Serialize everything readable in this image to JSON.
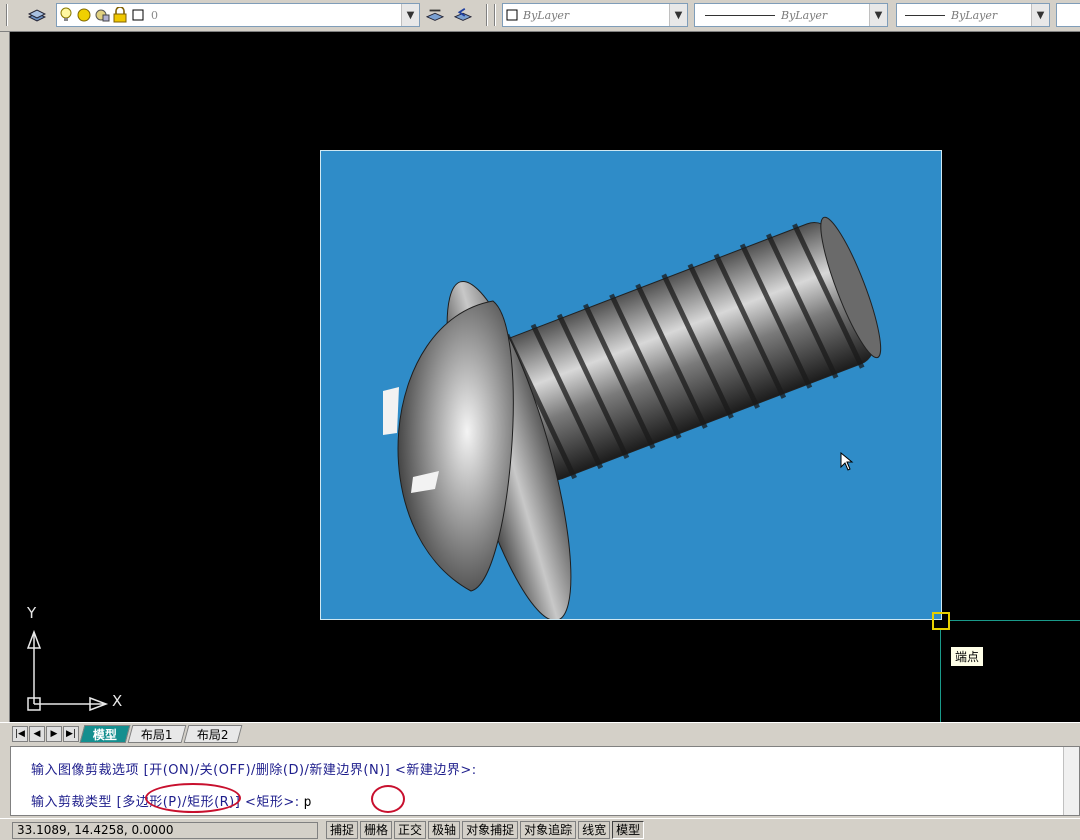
{
  "toolbar": {
    "layer_combo_value": "0",
    "color_combo_value": "ByLayer",
    "linetype_combo_value": "ByLayer",
    "lineweight_combo_value": "ByLayer"
  },
  "canvas": {
    "tooltip": "端点",
    "ucs_y_label": "Y",
    "ucs_x_label": "X",
    "background_color": "#000000",
    "image_bg_color": "#2f8cc8"
  },
  "tabs": [
    {
      "label": "模型",
      "active": true
    },
    {
      "label": "布局1",
      "active": false
    },
    {
      "label": "布局2",
      "active": false
    }
  ],
  "command": {
    "line1": "输入图像剪裁选项 [开(ON)/关(OFF)/删除(D)/新建边界(N)] <新建边界>:",
    "line2": "输入剪裁类型 [多边形(P)/矩形(R)] <矩形>:",
    "input": "p"
  },
  "status": {
    "coords": "33.1089, 14.4258, 0.0000",
    "buttons": [
      {
        "label": "捕捉",
        "pressed": false
      },
      {
        "label": "栅格",
        "pressed": false
      },
      {
        "label": "正交",
        "pressed": false
      },
      {
        "label": "极轴",
        "pressed": false
      },
      {
        "label": "对象捕捉",
        "pressed": false
      },
      {
        "label": "对象追踪",
        "pressed": false
      },
      {
        "label": "线宽",
        "pressed": false
      },
      {
        "label": "模型",
        "pressed": true
      }
    ]
  },
  "accent": {
    "tab_active": "#148f8f",
    "annotation_red": "#c8102e",
    "grip_yellow": "#e8d000"
  }
}
